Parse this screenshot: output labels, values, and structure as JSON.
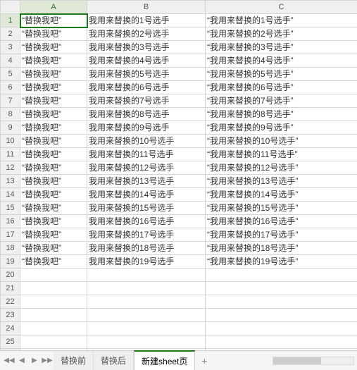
{
  "columns": [
    "A",
    "B",
    "C"
  ],
  "row_count": 27,
  "data_rows": 19,
  "selected_cell": {
    "row": 1,
    "col": "A"
  },
  "cells": {
    "colA_value": "“替换我吧”",
    "colB_prefix": "我用来替换的",
    "colB_suffix": "号选手",
    "colC_prefix": "“我用来替换的",
    "colC_suffix": "号选手”"
  },
  "tabs": [
    {
      "label": "替换前",
      "active": false
    },
    {
      "label": "替换后",
      "active": false
    },
    {
      "label": "新建sheet页",
      "active": true
    }
  ],
  "nav": {
    "first": "◀◀",
    "prev": "◀",
    "next": "▶",
    "last": "▶▶",
    "add": "+"
  },
  "watermark": ""
}
